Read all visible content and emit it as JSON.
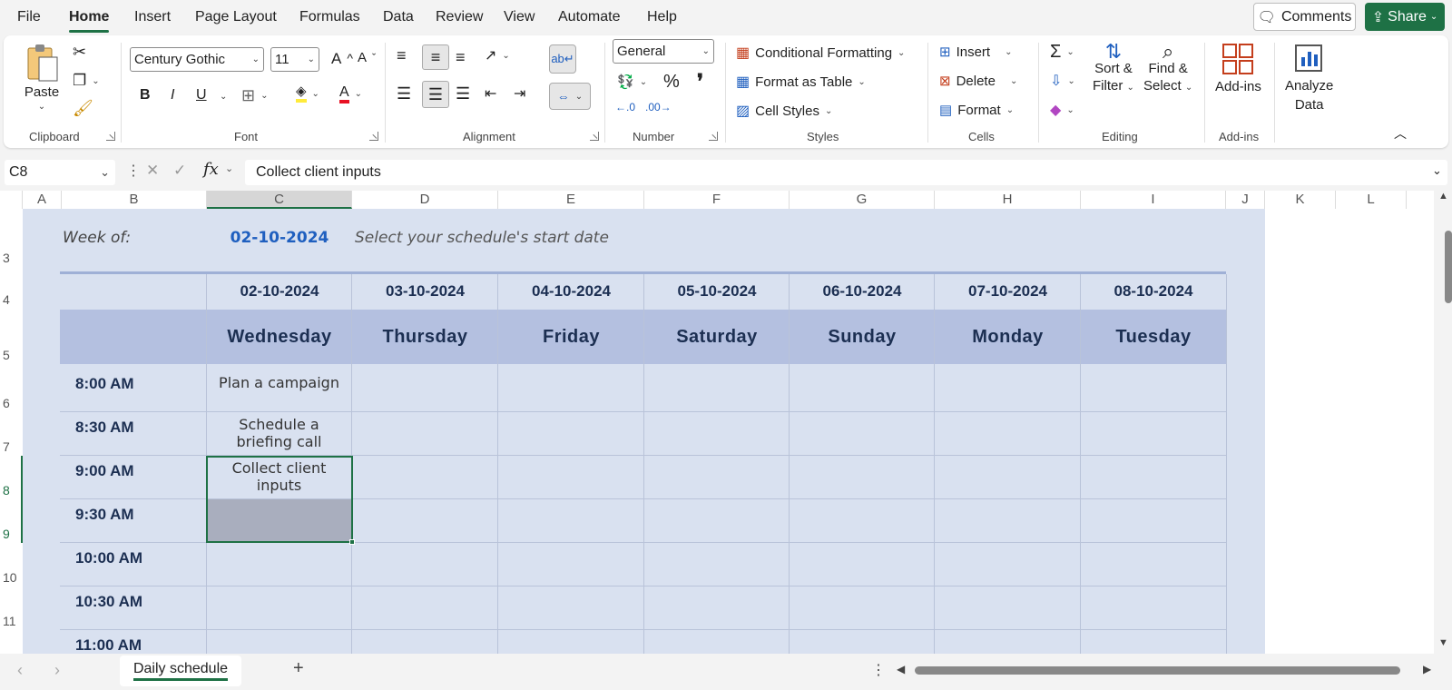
{
  "menu": {
    "items": [
      "File",
      "Home",
      "Insert",
      "Page Layout",
      "Formulas",
      "Data",
      "Review",
      "View",
      "Automate",
      "Help"
    ],
    "active": "Home",
    "comments_label": "Comments",
    "share_label": "Share"
  },
  "ribbon": {
    "clipboard": {
      "paste_label": "Paste",
      "group_label": "Clipboard"
    },
    "font": {
      "family": "Century Gothic",
      "size": "11",
      "bold": "B",
      "italic": "I",
      "underline": "U",
      "group_label": "Font",
      "fill_color": "#ffeb3b",
      "font_color": "#e81123"
    },
    "alignment": {
      "group_label": "Alignment"
    },
    "number": {
      "format": "General",
      "percent": "%",
      "comma": "❜",
      "group_label": "Number"
    },
    "styles": {
      "conditional": "Conditional Formatting",
      "format_table": "Format as Table",
      "cell_styles": "Cell Styles",
      "group_label": "Styles"
    },
    "cells": {
      "insert": "Insert",
      "delete": "Delete",
      "format": "Format",
      "group_label": "Cells"
    },
    "editing": {
      "sort_line1": "Sort &",
      "sort_line2": "Filter",
      "find_line1": "Find &",
      "find_line2": "Select",
      "group_label": "Editing"
    },
    "addins": {
      "label": "Add-ins",
      "group_label": "Add-ins"
    },
    "analyze": {
      "line1": "Analyze",
      "line2": "Data"
    }
  },
  "formula_bar": {
    "name_box": "C8",
    "fx": "fx",
    "content": "Collect client inputs"
  },
  "columns": [
    "A",
    "B",
    "C",
    "D",
    "E",
    "F",
    "G",
    "H",
    "I",
    "J",
    "K",
    "L"
  ],
  "rows": [
    "3",
    "4",
    "5",
    "6",
    "7",
    "8",
    "9",
    "10",
    "11"
  ],
  "sheet": {
    "week_label": "Week of:",
    "week_date": "02-10-2024",
    "week_hint": "Select your schedule's start date",
    "dates": [
      "02-10-2024",
      "03-10-2024",
      "04-10-2024",
      "05-10-2024",
      "06-10-2024",
      "07-10-2024",
      "08-10-2024"
    ],
    "days": [
      "Wednesday",
      "Thursday",
      "Friday",
      "Saturday",
      "Sunday",
      "Monday",
      "Tuesday"
    ],
    "times": [
      "8:00 AM",
      "8:30 AM",
      "9:00 AM",
      "9:30 AM",
      "10:00 AM",
      "10:30 AM",
      "11:00 AM"
    ],
    "tasks": {
      "t1": "Plan a campaign",
      "t2_line1": "Schedule a",
      "t2_line2": "briefing call",
      "t3_line1": "Collect client",
      "t3_line2": "inputs"
    },
    "colors": {
      "sheet_bg": "#d9e1f0",
      "header_bg": "#b4c0e0",
      "accent": "#1f5fbf",
      "selection": "#1e7145"
    }
  },
  "tabs": {
    "active": "Daily schedule",
    "add": "+"
  }
}
